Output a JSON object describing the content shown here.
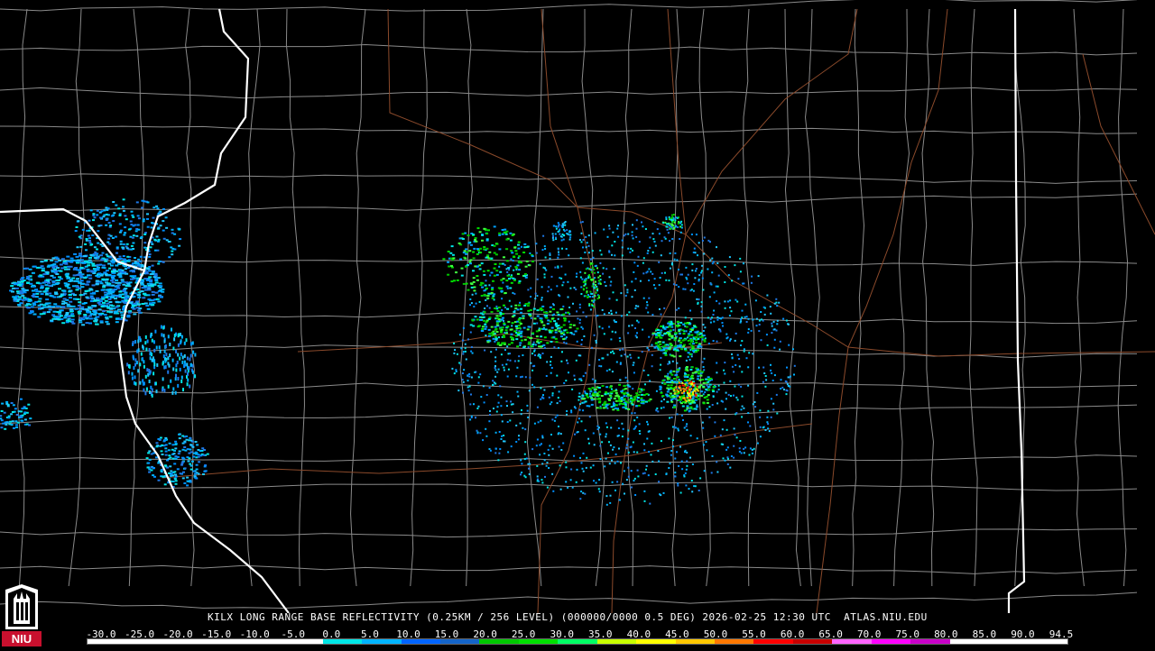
{
  "map": {
    "caption": "KILX LONG RANGE BASE REFLECTIVITY (0.25KM / 256 LEVEL) (000000/0000 0.5 DEG) 2026-02-25 12:30 UTC  ATLAS.NIU.EDU",
    "logo_text": "NIU",
    "colors": {
      "background": "#000000",
      "state_borders": "#ffffff",
      "county_lines": "#8a8a8a",
      "highways": "#8b4a2b"
    }
  },
  "scale": {
    "labels": [
      "-30.0",
      "-25.0",
      "-20.0",
      "-15.0",
      "-10.0",
      "-5.0",
      "0.0",
      "5.0",
      "10.0",
      "15.0",
      "20.0",
      "25.0",
      "30.0",
      "35.0",
      "40.0",
      "45.0",
      "50.0",
      "55.0",
      "60.0",
      "65.0",
      "70.0",
      "75.0",
      "80.0",
      "85.0",
      "90.0",
      "94.5"
    ],
    "swatches": [
      "#ffffff",
      "#ffffff",
      "#ffffff",
      "#ffffff",
      "#ffffff",
      "#ffffff",
      "#00e6e6",
      "#00b4ff",
      "#0064ff",
      "#1464c8",
      "#00c800",
      "#00e000",
      "#00ff64",
      "#c8ff00",
      "#ffff00",
      "#ffc800",
      "#ff7800",
      "#ff0000",
      "#c80000",
      "#ff64ff",
      "#ff00ff",
      "#c800c8",
      "#ffffff",
      "#ffffff",
      "#ffffff"
    ]
  }
}
